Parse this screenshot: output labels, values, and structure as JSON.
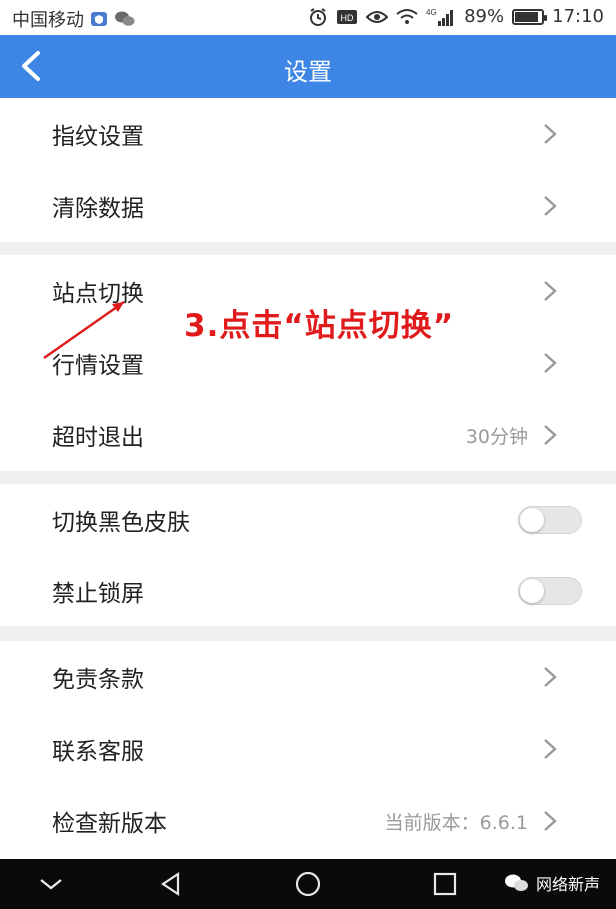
{
  "status_bar": {
    "carrier": "中国移动",
    "signal_tag": "4G",
    "battery": "89%",
    "battery_level": 0.89,
    "time": "17:10"
  },
  "header": {
    "title": "设置"
  },
  "sections": [
    {
      "items": [
        {
          "label": "指纹设置"
        },
        {
          "label": "清除数据"
        }
      ]
    },
    {
      "items": [
        {
          "label": "站点切换"
        },
        {
          "label": "行情设置"
        },
        {
          "label": "超时退出",
          "value": "30分钟"
        }
      ]
    },
    {
      "items": [
        {
          "label": "切换黑色皮肤",
          "toggle": false
        },
        {
          "label": "禁止锁屏",
          "toggle": false
        }
      ]
    },
    {
      "items": [
        {
          "label": "免责条款"
        },
        {
          "label": "联系客服"
        },
        {
          "label": "检查新版本",
          "value": "当前版本：6.6.1"
        }
      ]
    }
  ],
  "annotation": {
    "text": "3.点击“站点切换”"
  },
  "watermark": {
    "text": "网络新声"
  },
  "colors": {
    "header": "#3d86e6",
    "annotation": "#e11b1b",
    "navbar": "#0a0a0a"
  },
  "icons": [
    "back-chevron-icon",
    "chevron-right-icon",
    "alarm-icon",
    "eye-icon",
    "wifi-icon",
    "signal-icon",
    "battery-icon",
    "back-triangle-icon",
    "home-circle-icon",
    "recents-square-icon",
    "wechat-icon"
  ]
}
